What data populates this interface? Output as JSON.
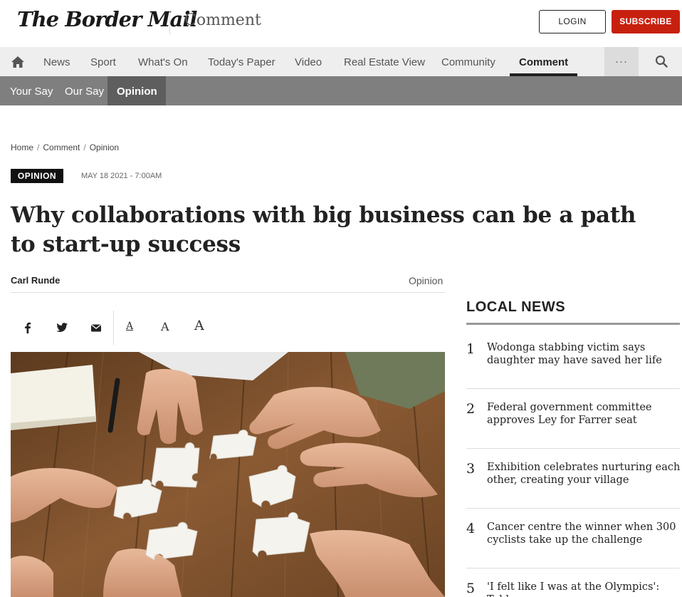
{
  "header": {
    "logo": "The Border Mail",
    "section": "Comment",
    "login_label": "LOGIN",
    "subscribe_label": "SUBSCRIBE",
    "subscribe_color": "#c8200f"
  },
  "nav": {
    "items": [
      "News",
      "Sport",
      "What's On",
      "Today's Paper",
      "Video",
      "Real Estate View",
      "Community",
      "Comment"
    ],
    "active": "Comment",
    "more_label": "···",
    "home_icon": "home-icon",
    "search_icon": "search-icon"
  },
  "subnav": {
    "items": [
      "Your Say",
      "Our Say",
      "Opinion"
    ],
    "active": "Opinion"
  },
  "breadcrumb": [
    "Home",
    "Comment",
    "Opinion"
  ],
  "article": {
    "tag": "OPINION",
    "date": "MAY 18 2021 - 7:00AM",
    "headline": "Why collaborations with big business can be a path to start-up success",
    "author": "Carl Runde",
    "category": "Opinion",
    "share_icons": [
      "facebook-icon",
      "twitter-icon",
      "email-icon"
    ],
    "font_size_labels": [
      "A",
      "A",
      "A"
    ]
  },
  "sidebar": {
    "title": "LOCAL NEWS",
    "items": [
      {
        "num": "1",
        "text": "Wodonga stabbing victim says daughter may have saved her life"
      },
      {
        "num": "2",
        "text": "Federal government committee approves Ley for Farrer seat"
      },
      {
        "num": "3",
        "text": "Exhibition celebrates nurturing each other, creating your village"
      },
      {
        "num": "4",
        "text": "Cancer centre the winner when 300 cyclists take up the challenge"
      },
      {
        "num": "5",
        "text": "'I felt like I was at the Olympics': Table"
      }
    ]
  }
}
